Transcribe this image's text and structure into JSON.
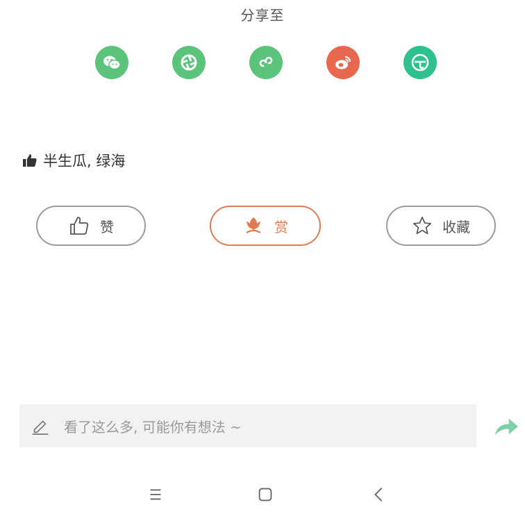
{
  "share": {
    "title": "分享至",
    "targets": [
      {
        "icon": "wechat-icon",
        "color": "#5cc37a"
      },
      {
        "icon": "moments-icon",
        "color": "#5cc37a"
      },
      {
        "icon": "mini-program-icon",
        "color": "#5cc37a"
      },
      {
        "icon": "weibo-icon",
        "color": "#e8674f"
      },
      {
        "icon": "umbrella-icon",
        "color": "#2fc08f"
      }
    ]
  },
  "likers": {
    "icon": "thumbs-up-icon",
    "names": "半生瓜, 绿海"
  },
  "actions": {
    "like_label": "赞",
    "reward_label": "赏",
    "favorite_label": "收藏",
    "reward_color": "#e07a52"
  },
  "comment": {
    "placeholder": "看了这么多, 可能你有想法 ~"
  },
  "colors": {
    "share_arrow": "#7fd0a4"
  }
}
